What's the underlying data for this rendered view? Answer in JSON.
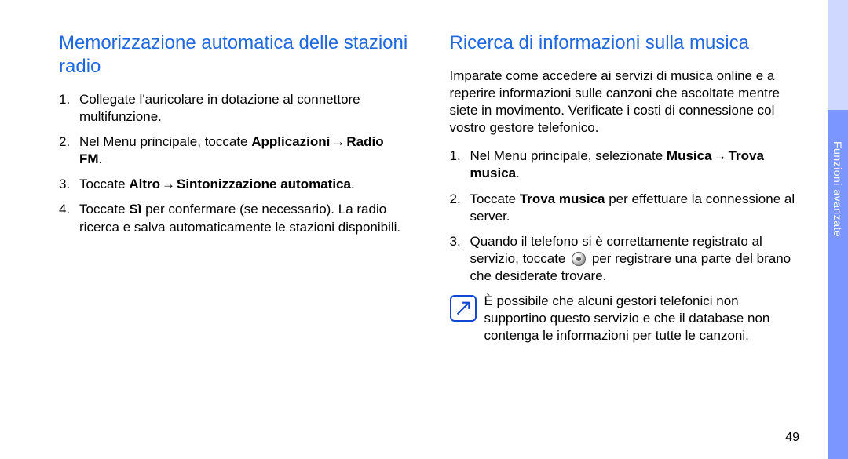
{
  "left": {
    "heading": "Memorizzazione automatica delle stazioni radio",
    "items": [
      {
        "num": "1.",
        "text_pre": "Collegate l'auricolare in dotazione al connettore multifunzione.",
        "bold1": "",
        "arrow1": "",
        "bold2": "",
        "text_post": ""
      },
      {
        "num": "2.",
        "text_pre": "Nel Menu principale,  toccate ",
        "bold1": "Applicazioni",
        "arrow1": " → ",
        "bold2": "Radio FM",
        "text_post": "."
      },
      {
        "num": "3.",
        "text_pre": "Toccate ",
        "bold1": "Altro",
        "arrow1": " → ",
        "bold2": "Sintonizzazione automatica",
        "text_post": "."
      },
      {
        "num": "4.",
        "text_pre": "Toccate ",
        "bold1": "Sì",
        "arrow1": "",
        "bold2": "",
        "text_post": " per confermare (se necessario). La radio ricerca e salva automaticamente le stazioni disponibili."
      }
    ]
  },
  "right": {
    "heading": "Ricerca di informazioni sulla musica",
    "intro": "Imparate come accedere ai servizi di musica online e a reperire informazioni sulle canzoni che ascoltate mentre siete in movimento. Verificate i costi di connessione col vostro gestore telefonico.",
    "items": [
      {
        "num": "1.",
        "text_pre": "Nel Menu principale, selezionate ",
        "bold1": "Musica",
        "arrow1": " → ",
        "bold2": "Trova musica",
        "text_post": "."
      },
      {
        "num": "2.",
        "text_pre": "Toccate ",
        "bold1": "Trova musica",
        "arrow1": "",
        "bold2": "",
        "text_post": " per effettuare la connessione al server."
      }
    ],
    "item3": {
      "num": "3.",
      "pre": "Quando il telefono si è correttamente registrato al servizio, toccate ",
      "post": " per registrare una parte del brano che desiderate trovare."
    },
    "note": "È possibile che alcuni gestori telefonici non supportino questo servizio e che il database non contenga le informazioni per tutte le canzoni."
  },
  "sidebar_label": "Funzioni avanzate",
  "page_number": "49"
}
